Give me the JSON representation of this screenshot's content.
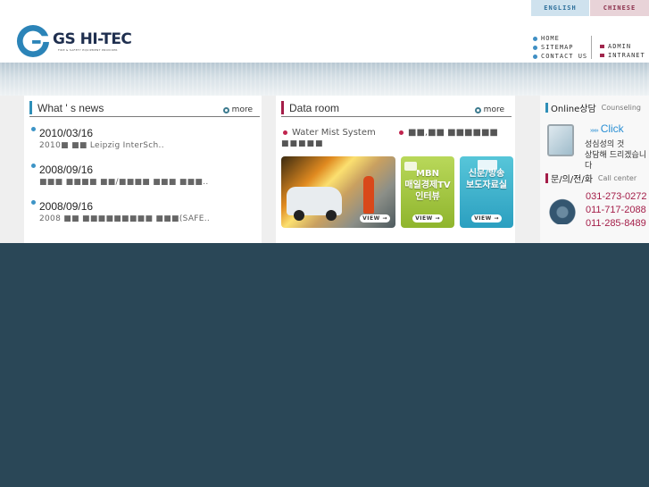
{
  "header": {
    "lang": {
      "english": "ENGLISH",
      "chinese": "CHINESE"
    },
    "logo": {
      "name": "GS HI-TEC",
      "tagline": "FIRE & SAFETY EQUIPMENT PROVIDER"
    },
    "nav_left": [
      "HOME",
      "SITEMAP",
      "CONTACT US"
    ],
    "nav_right": [
      "ADMIN",
      "INTRANET"
    ]
  },
  "news": {
    "title": "What ' s  news",
    "more": "more",
    "items": [
      {
        "date": "2010/03/16",
        "text": "2010■ ■■  Leipzig InterSch.."
      },
      {
        "date": "2008/09/16",
        "text": "■■■ ■■■■ ■■/■■■■ ■■■ ■■■.."
      },
      {
        "date": "2008/09/16",
        "text": "2008 ■■ ■■■■■■■■■ ■■■(SAFE.."
      }
    ]
  },
  "dataroom": {
    "title": "Data room",
    "more": "more",
    "links": [
      "Water Mist System",
      "■■,■■ ■■■■■■"
    ],
    "link_cont": "■■■■■",
    "thumbs": [
      {
        "title": "",
        "view": "VIEW"
      },
      {
        "title": "MBN\n매일경제TV\n인터뷰",
        "view": "VIEW"
      },
      {
        "title": "신문/방송\n보도자료실",
        "view": "VIEW"
      }
    ]
  },
  "sidebar": {
    "counsel": {
      "ko": "Online상담",
      "en": "Counseling",
      "click": "Click",
      "message": "성심성의 것\n상담해 드리겠습니다"
    },
    "call": {
      "ko": "문/의/전/화",
      "en": "Call center",
      "numbers": [
        "031-273-0272",
        "011-717-2088",
        "011-285-8489"
      ]
    }
  },
  "colors": {
    "accent_blue": "#3d94c6",
    "accent_red": "#a41d48",
    "footer_bg": "#2a4757"
  }
}
